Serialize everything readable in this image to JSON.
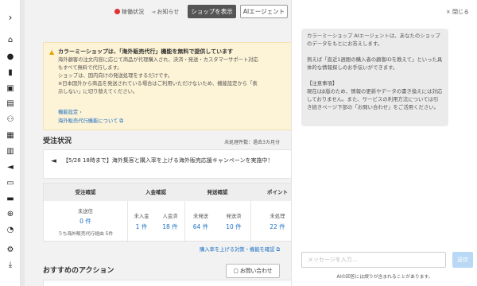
{
  "rail": {
    "icons": [
      "chevron-right-icon",
      "home-icon",
      "user-icon",
      "bookmark-icon",
      "save-icon",
      "clipboard-icon",
      "users-icon",
      "store-icon",
      "bar-chart-icon",
      "megaphone-icon",
      "id-card-icon",
      "inbox-icon",
      "plus-circle-icon",
      "history-icon",
      "settings-icon",
      "download-icon"
    ]
  },
  "topbar": {
    "status": "稼働状況",
    "news": "お知らせ",
    "shop_button": "ショップを表示",
    "ai_button": "AIエージェント"
  },
  "notice": {
    "title": "カラーミーショップは、「海外販売代行」機能を無料で提供しています",
    "body_lines": [
      "海外顧客の注文内容に応じて商品が代理購入され、決済・発送・カスタマーサポート対応",
      "もすべて無料で代行します。",
      "ショップは、国内向けの発送処理をするだけです。",
      "※日本国外から商品を発送されている場合はご利用いただけないため、機能設定から「表",
      "示しない」に切り替えてください。"
    ],
    "link_settings": "機能設定 ›",
    "link_about": "海外販売代行機能について ⧉",
    "close": "×"
  },
  "order_status": {
    "title": "受注状況",
    "meta": "未処理件数：過去3カ月分",
    "campaign": "【5/28 18時まで】海外集客と購入率を上げる海外販売応援キャンペーンを実施中！",
    "columns": [
      "受注確認",
      "入金確認",
      "発送確認",
      "ポイント"
    ],
    "confirm_label": "未送信",
    "confirm_value": "0 件",
    "confirm_sub": "うち海外販売代行経由 5件",
    "payment": [
      {
        "label": "未入金",
        "value": "1 件"
      },
      {
        "label": "入金済",
        "value": "18 件"
      }
    ],
    "shipping": [
      {
        "label": "未発送",
        "value": "64 件"
      },
      {
        "label": "発送済",
        "value": "10 件"
      }
    ],
    "points_label": "未処理",
    "points_value": "22 件",
    "link": "購入率を上げる対策・機能を確認 ⧉"
  },
  "actions": {
    "title": "おすすめのアクション",
    "contact_button": "お問い合わせ"
  },
  "ai_panel": {
    "close": "× 閉じる",
    "message": [
      "カラーミーショップ AIエージェントは、あなたのショップのデータをもとにお答えします。",
      "例えば「直近1週間の購入者の顧客IDを教えて」といった具体的な情報探しのお手伝いができます。",
      "【注意事項】\n現在はβ版のため、情報の更新やデータの書き換えには対応しておりません。また、サービスの利用方法については引き続きページ下部の「お問い合わせ」をご活用ください。"
    ],
    "input_placeholder": "メッセージを入力...",
    "send": "送信",
    "disclaimer": "AIの回答には誤りが含まれることがあります。"
  }
}
